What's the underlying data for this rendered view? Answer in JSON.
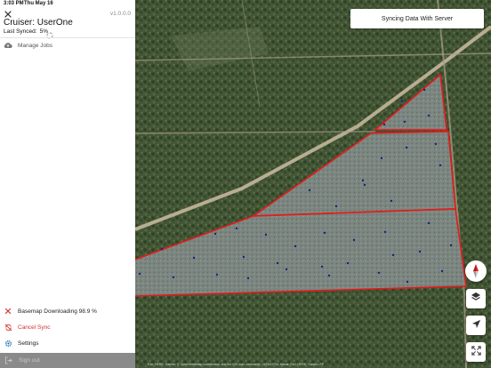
{
  "status_bar": {
    "time": "3:03 PM",
    "date": "Thu May 16"
  },
  "sidebar": {
    "version": "v1.0.0.0",
    "title": "Cruiser: UserOne",
    "last_synced_label": "Last Synced:",
    "last_synced_value": "5%",
    "menu": [
      {
        "label": "Manage Jobs",
        "icon": "cloud-upload-icon"
      }
    ],
    "bottom_menu": [
      {
        "label": "Basemap Downloading 98.9 %",
        "icon": "close-icon"
      },
      {
        "label": "Cancel Sync",
        "icon": "sync-off-icon"
      },
      {
        "label": "Settings",
        "icon": "gear-icon"
      }
    ],
    "sign_out": {
      "label": "Sign out",
      "icon": "logout-icon"
    }
  },
  "map": {
    "sync_toast": "Syncing Data With Server",
    "controls": [
      "compass-icon",
      "layers-icon",
      "location-arrow-icon",
      "fullscreen-icon"
    ],
    "attribution": "Esri, HERE, Garmin, © OpenStreetMap contributors, and the GIS user community | USDA FSA, Maxar, Esri, HERE, Garmin, FP",
    "colors": {
      "stand_outline": "#e31b1b",
      "plot_point": "#1a237e",
      "forest": "#3f5230"
    }
  }
}
